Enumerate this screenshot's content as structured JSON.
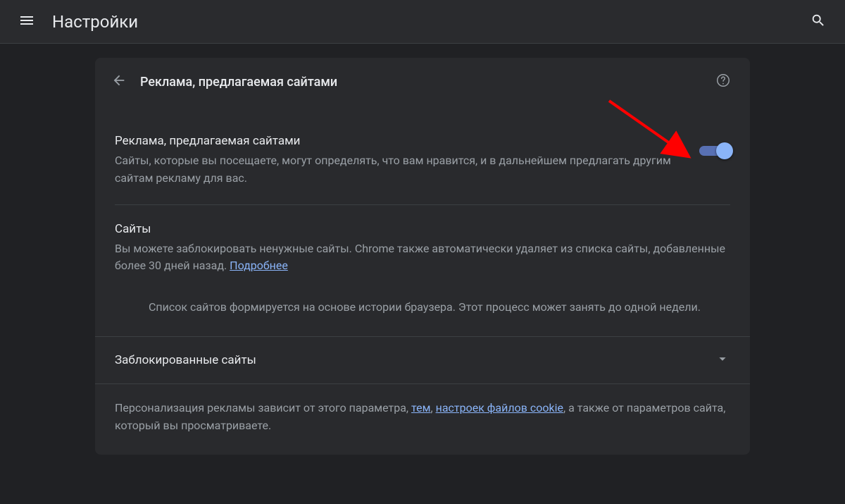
{
  "appbar": {
    "title": "Настройки"
  },
  "panel": {
    "back_aria": "Назад",
    "title": "Реклама, предлагаемая сайтами",
    "help_aria": "Справка"
  },
  "main_setting": {
    "title": "Реклама, предлагаемая сайтами",
    "description": "Сайты, которые вы посещаете, могут определять, что вам нравится, и в дальнейшем предлагать другим сайтам рекламу для вас.",
    "toggle_on": true
  },
  "sites_section": {
    "title": "Сайты",
    "description_before_link": "Вы можете заблокировать ненужные сайты. Chrome также автоматически удаляет из списка сайты, добавленные более 30 дней назад. ",
    "learn_more": "Подробнее",
    "note": "Список сайтов формируется на основе истории браузера. Этот процесс может занять до одной недели."
  },
  "blocked_sites": {
    "label": "Заблокированные сайты"
  },
  "footer": {
    "text_before": "Персонализация рекламы зависит от этого параметра, ",
    "link_themes": "тем",
    "text_mid": ", ",
    "link_cookies": "настроек файлов cookie",
    "text_after": ", а также от параметров сайта, который вы просматриваете."
  },
  "icons": {
    "menu": "menu-icon",
    "search": "search-icon",
    "back": "arrow-left-icon",
    "help": "help-circle-icon",
    "chevron": "chevron-down-icon"
  },
  "colors": {
    "bg": "#202124",
    "panel": "#292a2d",
    "text_primary": "#e8eaed",
    "text_secondary": "#9aa0a6",
    "accent": "#8ab4f8",
    "annotation": "#ff0000"
  }
}
